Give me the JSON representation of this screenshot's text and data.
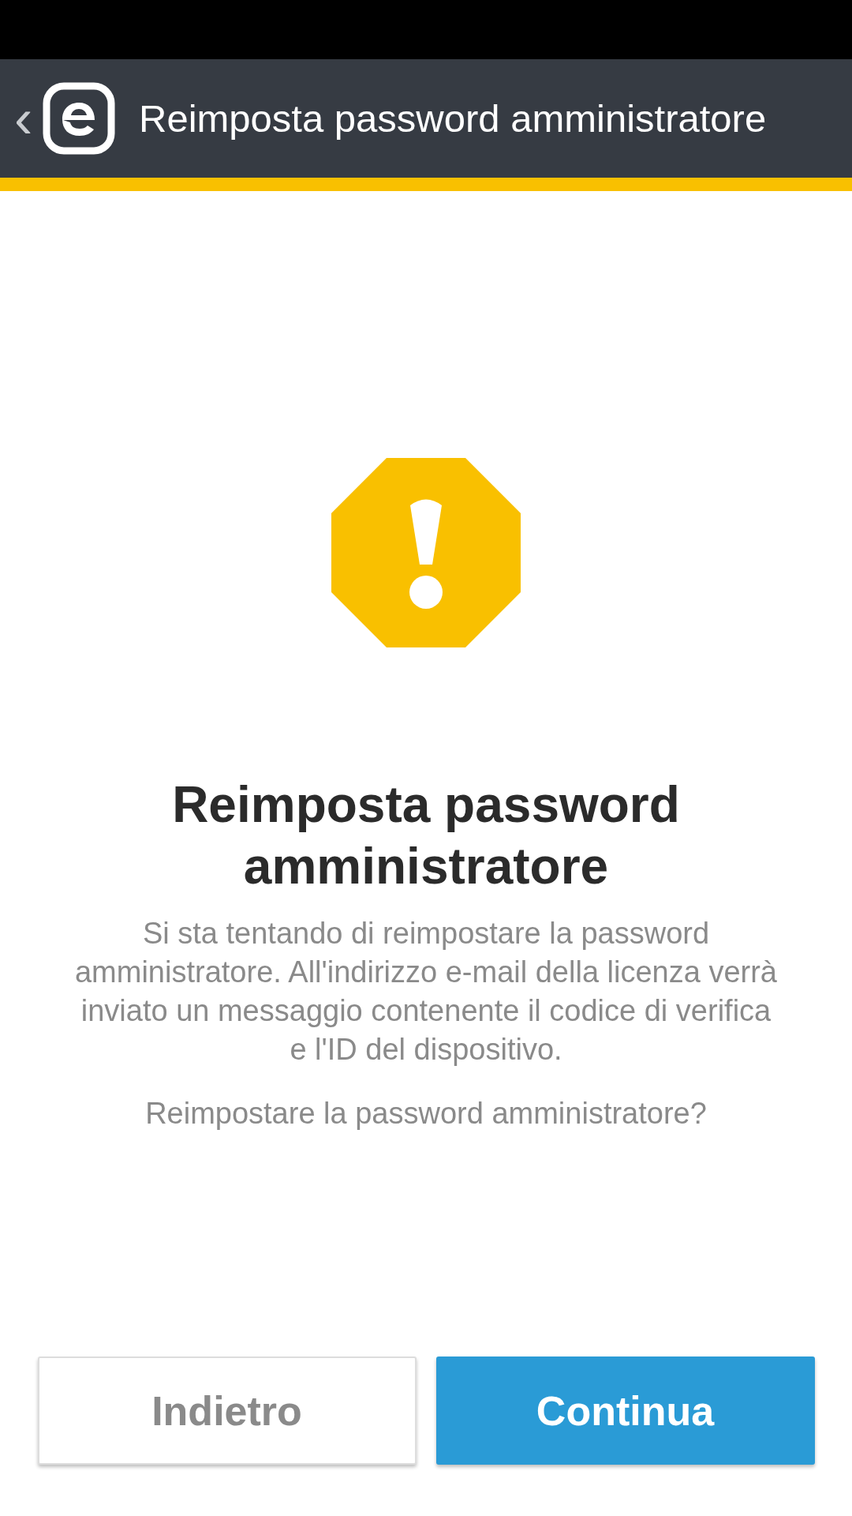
{
  "app_bar": {
    "back": "‹",
    "title": "Reimposta password amministratore"
  },
  "dialog": {
    "heading": "Reimposta password amministratore",
    "message": "Si sta tentando di reimpostare la password amministratore. All'indirizzo e-mail della licenza verrà inviato un messaggio contenente il codice di verifica e l'ID del dispositivo.",
    "question": "Reimpostare la password amministratore?"
  },
  "buttons": [
    {
      "label": "Indietro",
      "kind": "secondary"
    },
    {
      "label": "Continua",
      "kind": "primary"
    }
  ]
}
